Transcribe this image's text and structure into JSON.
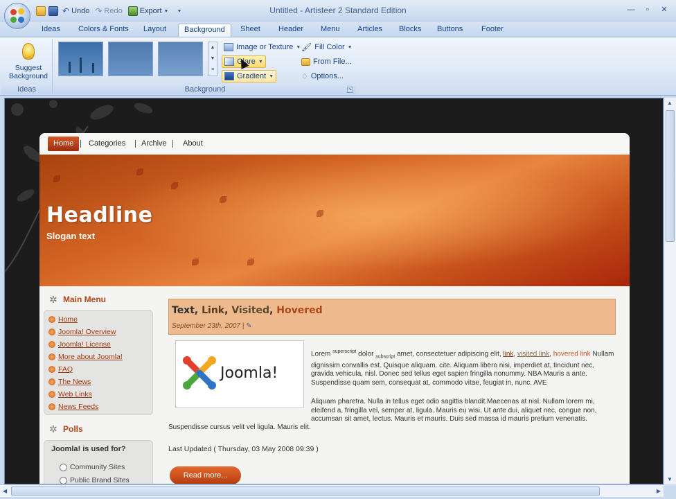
{
  "titlebar": {
    "title": "Untitled - Artisteer 2 Standard Edition",
    "undo_label": "Undo",
    "redo_label": "Redo",
    "export_label": "Export"
  },
  "tabs": [
    "Ideas",
    "Colors & Fonts",
    "Layout",
    "Background",
    "Sheet",
    "Header",
    "Menu",
    "Articles",
    "Blocks",
    "Buttons",
    "Footer"
  ],
  "active_tab": "Background",
  "ribbon": {
    "suggest_label_1": "Suggest",
    "suggest_label_2": "Background",
    "ideas_group": "Ideas",
    "background_group": "Background",
    "image_texture": "Image or Texture",
    "glare": "Glare",
    "gradient": "Gradient",
    "fill_color": "Fill Color",
    "from_file": "From File...",
    "options": "Options..."
  },
  "preview": {
    "nav": [
      "Home",
      "Categories",
      "Archive",
      "About"
    ],
    "headline": "Headline",
    "slogan": "Slogan text",
    "main_menu_title": "Main Menu",
    "menu_items": [
      "Home",
      "Joomla! Overview",
      "Joomla! License",
      "More about Joomla!",
      "FAQ",
      "The News",
      "Web Links",
      "News Feeds"
    ],
    "polls_title": "Polls",
    "poll_question": "Joomla! is used for?",
    "poll_options": [
      "Community Sites",
      "Public Brand Sites"
    ],
    "post": {
      "t_text": "Text",
      "t_link": "Link",
      "t_visited": "Visited",
      "t_hovered": "Hovered",
      "date": "September 23th, 2007 |",
      "logo_text": "Joomla!",
      "p1_a": "Lorem",
      "p1_sup": "superscript",
      "p1_b": "dolor",
      "p1_sub": "subscript",
      "p1_c": "amet, consectetuer adipiscing elit,",
      "p1_link": "link",
      "p1_visited": "visited link",
      "p1_hovered": "hovered link",
      "p1_rest": "Nullam dignissim convallis est. Quisque aliquam. cite. Aliquam libero nisi, imperdiet at, tincidunt nec, gravida vehicula, nisl. Donec sed tellus eget sapien fringilla nonummy. NBA Mauris a ante. Suspendisse quam sem, consequat at, commodo vitae, feugiat in, nunc. AVE",
      "p2": "Aliquam pharetra. Nulla in tellus eget odio sagittis blandit.Maecenas at nisl. Nullam lorem mi, eleifend a, fringilla vel, semper at, ligula. Mauris eu wisi. Ut ante dui, aliquet nec, congue non, accumsan sit amet, lectus. Mauris et mauris. Duis sed massa id mauris pretium venenatis.",
      "p3": "Suspendisse cursus velit vel ligula. Mauris elit.",
      "updated": "Last Updated ( Thursday, 03 May 2008 09:39 )",
      "read_more": "Read more..."
    }
  },
  "colors": {
    "accent": "#b2461a",
    "ribbon": "#dfe9f7",
    "header_orange": "#d46424"
  }
}
